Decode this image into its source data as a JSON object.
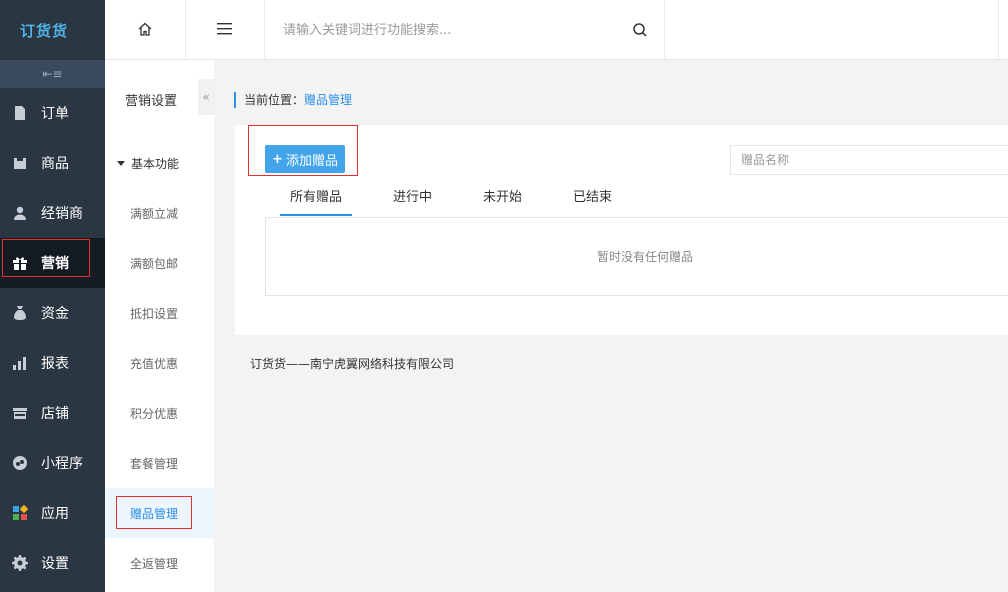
{
  "app": {
    "logo_text": "订货货"
  },
  "sidebar": {
    "items": [
      {
        "label": "订单",
        "icon": "document-icon"
      },
      {
        "label": "商品",
        "icon": "box-icon"
      },
      {
        "label": "经销商",
        "icon": "user-icon"
      },
      {
        "label": "营销",
        "icon": "gift-icon",
        "active": true
      },
      {
        "label": "资金",
        "icon": "money-bag-icon"
      },
      {
        "label": "报表",
        "icon": "bar-chart-icon"
      },
      {
        "label": "店铺",
        "icon": "store-icon"
      },
      {
        "label": "小程序",
        "icon": "mini-program-icon"
      },
      {
        "label": "应用",
        "icon": "apps-icon"
      },
      {
        "label": "设置",
        "icon": "gear-icon"
      }
    ]
  },
  "topbar": {
    "search_placeholder": "请输入关键词进行功能搜索..."
  },
  "subnav": {
    "title": "营销设置",
    "group": "基本功能",
    "items": [
      {
        "label": "满额立减"
      },
      {
        "label": "满额包邮"
      },
      {
        "label": "抵扣设置"
      },
      {
        "label": "充值优惠"
      },
      {
        "label": "积分优惠"
      },
      {
        "label": "套餐管理"
      },
      {
        "label": "赠品管理",
        "active": true
      },
      {
        "label": "全返管理"
      }
    ]
  },
  "breadcrumb": {
    "prefix": "当前位置：",
    "current": "赠品管理"
  },
  "toolbar": {
    "add_label": "添加赠品",
    "name_placeholder": "赠品名称"
  },
  "tabs": [
    {
      "label": "所有赠品",
      "active": true
    },
    {
      "label": "进行中"
    },
    {
      "label": "未开始"
    },
    {
      "label": "已结束"
    }
  ],
  "empty_text": "暂时没有任何赠品",
  "footer": "订货货——南宁虎翼网络科技有限公司",
  "colors": {
    "accent": "#2b8ee8",
    "button": "#42a5ec",
    "sidebar_bg": "#2b3643",
    "highlight": "#e23030"
  }
}
